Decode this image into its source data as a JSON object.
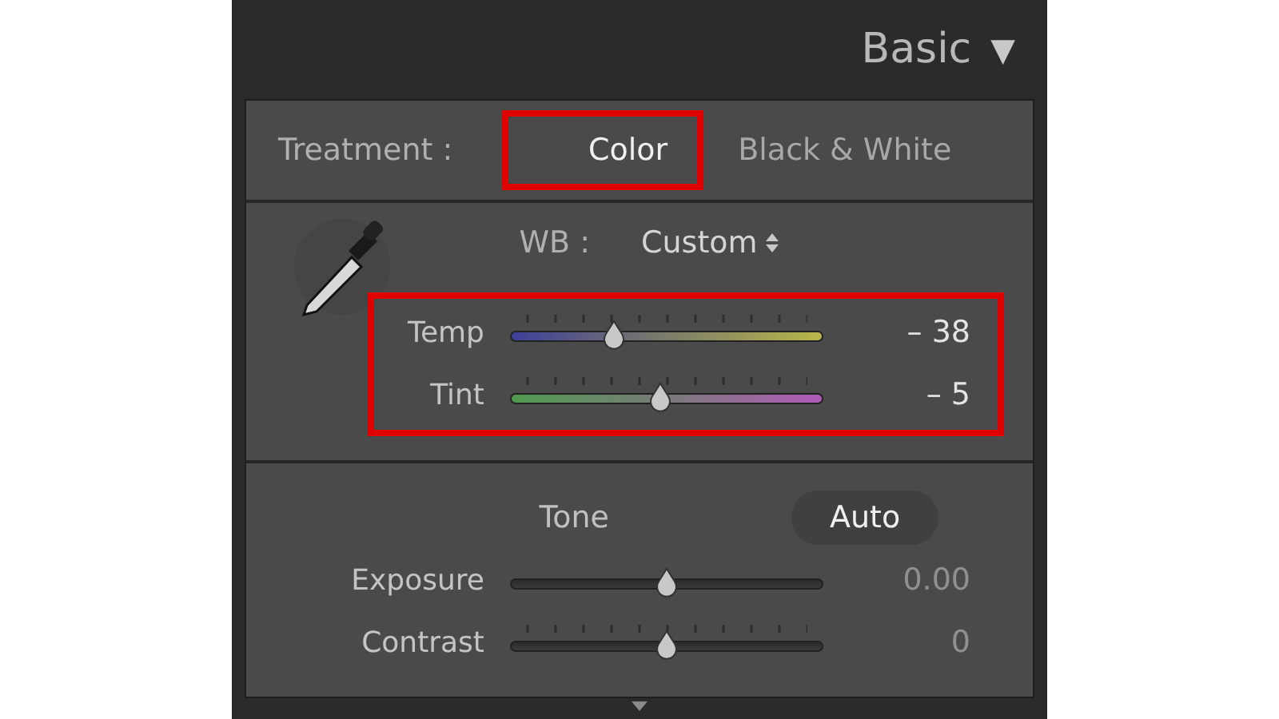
{
  "panel": {
    "title": "Basic",
    "collapse_icon": "▼"
  },
  "treatment": {
    "label": "Treatment :",
    "options": [
      {
        "label": "Color",
        "selected": true,
        "highlighted": true
      },
      {
        "label": "Black & White",
        "selected": false,
        "highlighted": false
      }
    ]
  },
  "white_balance": {
    "label": "WB :",
    "value": "Custom",
    "highlighted": true,
    "sliders": [
      {
        "kind": "temp",
        "label": "Temp",
        "level": 0.33,
        "reading": "– 38",
        "ticks": true
      },
      {
        "kind": "tint",
        "label": "Tint",
        "level": 0.48,
        "reading": "– 5",
        "ticks": true
      }
    ]
  },
  "tone": {
    "label": "Tone",
    "auto_button": "Auto",
    "sliders": [
      {
        "kind": "plain",
        "label": "Exposure",
        "level": 0.5,
        "reading": "0.00",
        "ticks": false
      },
      {
        "kind": "plain",
        "label": "Contrast",
        "level": 0.5,
        "reading": "0",
        "ticks": true
      }
    ]
  }
}
